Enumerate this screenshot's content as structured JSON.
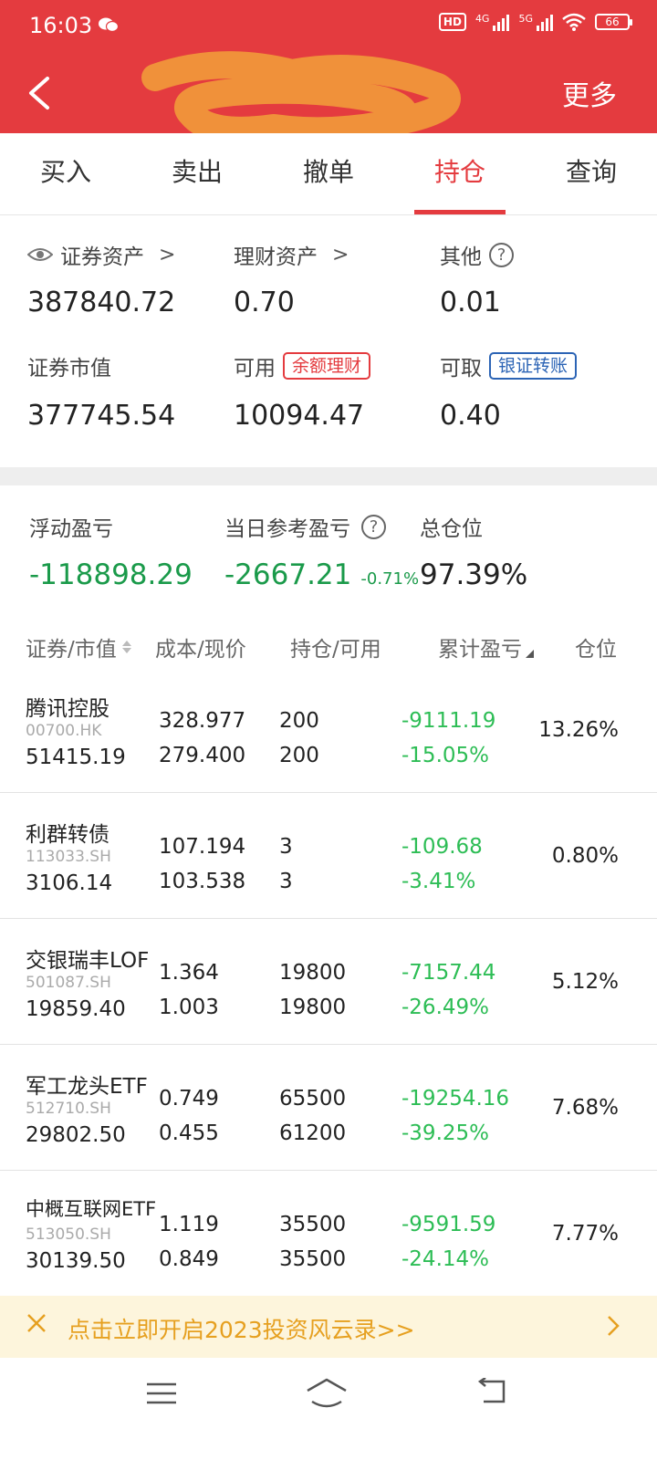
{
  "status_bar": {
    "time": "16:03",
    "hd_label": "HD",
    "signal_4g": "4G",
    "signal_5g": "5G",
    "battery": "66"
  },
  "header": {
    "more_label": "更多"
  },
  "tabs": [
    {
      "label": "买入"
    },
    {
      "label": "卖出"
    },
    {
      "label": "撤单"
    },
    {
      "label": "持仓",
      "active": true
    },
    {
      "label": "查询"
    }
  ],
  "assets": {
    "securities_assets_label": "证券资产",
    "securities_assets_value": "387840.72",
    "wealth_assets_label": "理财资产",
    "wealth_assets_value": "0.70",
    "other_label": "其他",
    "other_value": "0.01",
    "market_value_label": "证券市值",
    "market_value_value": "377745.54",
    "available_label": "可用",
    "available_tag": "余额理财",
    "available_value": "10094.47",
    "withdrawable_label": "可取",
    "withdrawable_tag": "银证转账",
    "withdrawable_value": "0.40"
  },
  "summary": {
    "floating_pnl_label": "浮动盈亏",
    "floating_pnl_value": "-118898.29",
    "daily_pnl_label": "当日参考盈亏",
    "daily_pnl_value": "-2667.21",
    "daily_pnl_pct": "-0.71%",
    "total_position_label": "总仓位",
    "total_position_value": "97.39%"
  },
  "table": {
    "headers": {
      "security": "证券/市值",
      "cost": "成本/现价",
      "hold": "持仓/可用",
      "pnl": "累计盈亏",
      "position": "仓位"
    },
    "rows": [
      {
        "name": "腾讯控股",
        "code": "00700.HK",
        "market_value": "51415.19",
        "cost": "328.977",
        "price": "279.400",
        "hold": "200",
        "available": "200",
        "pnl": "-9111.19",
        "pnl_pct": "-15.05%",
        "position": "13.26%"
      },
      {
        "name": "利群转债",
        "code": "113033.SH",
        "market_value": "3106.14",
        "cost": "107.194",
        "price": "103.538",
        "hold": "3",
        "available": "3",
        "pnl": "-109.68",
        "pnl_pct": "-3.41%",
        "position": "0.80%"
      },
      {
        "name": "交银瑞丰LOF",
        "code": "501087.SH",
        "market_value": "19859.40",
        "cost": "1.364",
        "price": "1.003",
        "hold": "19800",
        "available": "19800",
        "pnl": "-7157.44",
        "pnl_pct": "-26.49%",
        "position": "5.12%"
      },
      {
        "name": "军工龙头ETF",
        "code": "512710.SH",
        "market_value": "29802.50",
        "cost": "0.749",
        "price": "0.455",
        "hold": "65500",
        "available": "61200",
        "pnl": "-19254.16",
        "pnl_pct": "-39.25%",
        "position": "7.68%"
      },
      {
        "name": "中概互联网ETF",
        "code": "513050.SH",
        "market_value": "30139.50",
        "cost": "1.119",
        "price": "0.849",
        "hold": "35500",
        "available": "35500",
        "pnl": "-9591.59",
        "pnl_pct": "-24.14%",
        "position": "7.77%"
      }
    ]
  },
  "banner": {
    "text": "点击立即开启2023投资风云录>>"
  },
  "colors": {
    "brand_red": "#e43b3f",
    "loss_green": "#2dbd55",
    "banner_text": "#e6a020",
    "transfer_blue": "#2c64b5"
  }
}
